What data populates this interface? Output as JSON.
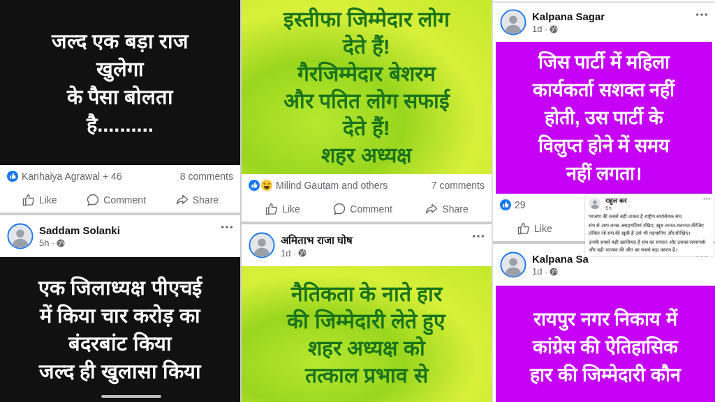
{
  "columns": [
    {
      "blocks": [
        {
          "kind": "post",
          "lines": [
            "जल्द एक बड़ा राज",
            "खुलेगा",
            "के पैसा बोलता",
            "है.........."
          ]
        },
        {
          "kind": "reactions",
          "names": "Kanhaiya Agrawal + 46",
          "comments": "8 comments"
        },
        {
          "kind": "actions",
          "actions": [
            "Like",
            "Comment",
            "Share"
          ]
        },
        {
          "kind": "header",
          "name": "Saddam Solanki",
          "time": "5h ·"
        },
        {
          "kind": "post",
          "lines": [
            "एक जिलाध्यक्ष पीएचई",
            "में किया चार करोड़ का",
            "बंदरबांट  किया",
            "जल्द ही खुलासा किया"
          ]
        }
      ]
    },
    {
      "blocks": [
        {
          "kind": "post",
          "lines": [
            "इस्तीफा जिम्मेदार लोग",
            "देते हैं!",
            "गैरजिम्मेदार बेशरम",
            "और पतित लोग सफाई",
            "देते हैं!",
            "शहर अध्यक्ष"
          ]
        },
        {
          "kind": "reactions",
          "names": "Milind Gautam and others",
          "comments": "7 comments"
        },
        {
          "kind": "actions",
          "actions": [
            "Like",
            "Comment",
            "Share"
          ]
        },
        {
          "kind": "header",
          "name": "अमिताभ राजा घोष",
          "time": "1d ·"
        },
        {
          "kind": "post",
          "lines": [
            "नैतिकता के नाते हार",
            "की जिम्मेदारी लेते हुए",
            "शहर अध्यक्ष को",
            "तत्काल प्रभाव से"
          ]
        }
      ]
    },
    {
      "blocks": [
        {
          "kind": "header",
          "name": "Kalpana Sagar",
          "time": "1d ·"
        },
        {
          "kind": "post",
          "lines": [
            "जिस पार्टी में महिला",
            "कार्यकर्ता सशक्त नहीं",
            "होती, उस पार्टी के",
            "विलुप्त होने में समय",
            "नहीं लगता।"
          ]
        },
        {
          "kind": "reactions",
          "names": "29"
        },
        {
          "kind": "actions",
          "actions": [
            "Like"
          ]
        },
        {
          "kind": "header",
          "name": "Kalpana Sa",
          "time": "1d ·"
        },
        {
          "kind": "post",
          "lines": [
            "रायपुर नगर निकाय में",
            "कांग्रेस की ऐतिहासिक",
            "हार की जिम्मेदारी कौन"
          ]
        }
      ],
      "overlay": {
        "name": "राहुल कर",
        "time": "5h ·",
        "text": [
          "भाजपा की सबसे बड़ी ताकत है राष्ट्रीय स्वयंसेवक संघ.",
          "संघ से आप लाख असहमतियां रखिए, खूब लानत-मलानत कीजिए लेकिन जो संघ की खूबी है उसे भी पहचानिए और सीखिए।",
          "उनकी सबसे बड़ी खासियत है संघ का संगठन और उसका जनसंपर्क और यही भाजपा की जीत का सबसे बड़ा कारण है।"
        ]
      }
    }
  ]
}
